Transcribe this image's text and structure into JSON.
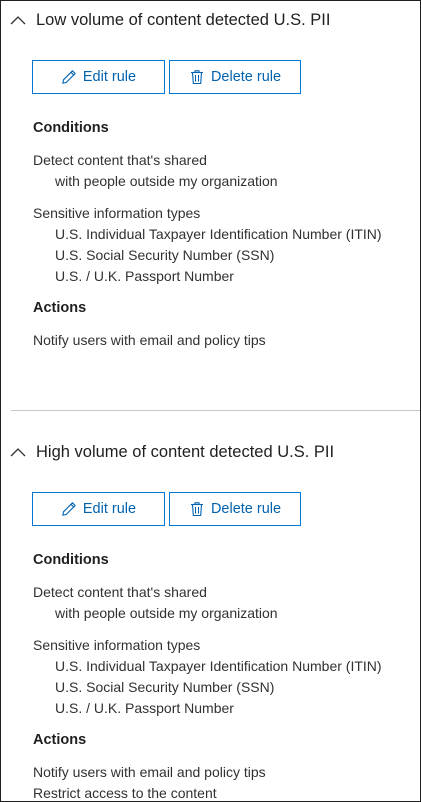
{
  "rules": [
    {
      "title": "Low volume of content detected U.S. PII",
      "edit_label": "Edit rule",
      "delete_label": "Delete rule",
      "conditions_heading": "Conditions",
      "detect_line1": "Detect content that's shared",
      "detect_line2": "with people outside my organization",
      "sensitive_heading": "Sensitive information types",
      "sensitive_types": [
        "U.S. Individual Taxpayer Identification Number (ITIN)",
        "U.S. Social Security Number (SSN)",
        "U.S. / U.K. Passport Number"
      ],
      "actions_heading": "Actions",
      "actions": [
        "Notify users with email and policy tips"
      ]
    },
    {
      "title": "High volume of content detected U.S. PII",
      "edit_label": "Edit rule",
      "delete_label": "Delete rule",
      "conditions_heading": "Conditions",
      "detect_line1": "Detect content that's shared",
      "detect_line2": "with people outside my organization",
      "sensitive_heading": "Sensitive information types",
      "sensitive_types": [
        "U.S. Individual Taxpayer Identification Number (ITIN)",
        "U.S. Social Security Number (SSN)",
        "U.S. / U.K. Passport Number"
      ],
      "actions_heading": "Actions",
      "actions": [
        "Notify users with email and policy tips",
        "Restrict access to the content"
      ]
    }
  ],
  "icons": {
    "collapse": "chevron-up-icon",
    "edit": "pencil-icon",
    "delete": "trash-icon"
  },
  "colors": {
    "accent": "#0078d4",
    "button_text": "#0063b1",
    "text": "#323130",
    "divider": "#c8c6c4",
    "border": "#1f1f1f"
  }
}
